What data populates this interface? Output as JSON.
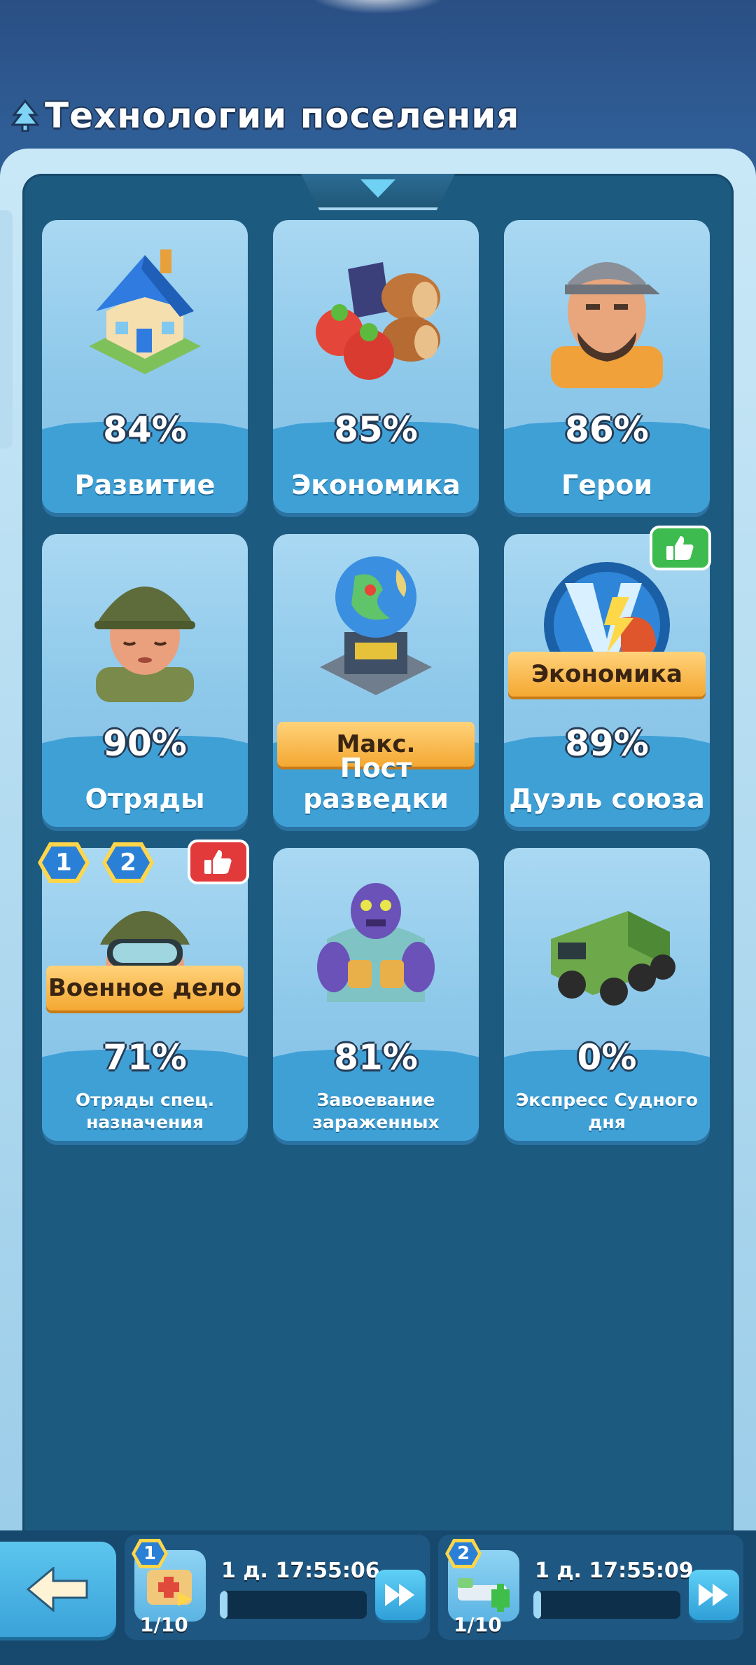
{
  "header": {
    "title": "Технологии поселения",
    "icon": "tree-icon"
  },
  "cards": [
    {
      "label": "Развитие",
      "percent": "84%",
      "art": "house-icon"
    },
    {
      "label": "Экономика",
      "percent": "85%",
      "art": "resources-icon"
    },
    {
      "label": "Герои",
      "percent": "86%",
      "art": "hero-portrait-icon"
    },
    {
      "label": "Отряды",
      "percent": "90%",
      "art": "soldier-helmet-icon"
    },
    {
      "label": "Пост разведки",
      "percent": "",
      "ribbon": "Макс.",
      "art": "radar-globe-icon"
    },
    {
      "label": "Дуэль союза",
      "percent": "89%",
      "ribbon": "Экономика",
      "art": "versus-icon",
      "badge": "thumbs-up-green"
    },
    {
      "label": "Отряды спец. назначения",
      "percent": "71%",
      "ribbon": "Военное дело",
      "art": "goggles-soldier-icon",
      "badge": "thumbs-up-red",
      "level_badges": [
        "1",
        "2"
      ]
    },
    {
      "label": "Завоевание зараженных",
      "percent": "81%",
      "art": "zombie-icon"
    },
    {
      "label": "Экспресс Судного дня",
      "percent": "0%",
      "art": "armored-truck-icon"
    }
  ],
  "queues": [
    {
      "slot": "1",
      "time": "1 д. 17:55:06",
      "count": "1/10",
      "progress": 0.05,
      "icon": "research-kit-icon"
    },
    {
      "slot": "2",
      "time": "1 д. 17:55:09",
      "count": "1/10",
      "progress": 0.05,
      "icon": "medical-bed-icon"
    }
  ],
  "colors": {
    "panel": "#1d5a80",
    "card": "#a9d8f2",
    "card_footer": "#3fa0d6",
    "ribbon": "#f4a832",
    "accent_button": "#3aa2d8"
  }
}
